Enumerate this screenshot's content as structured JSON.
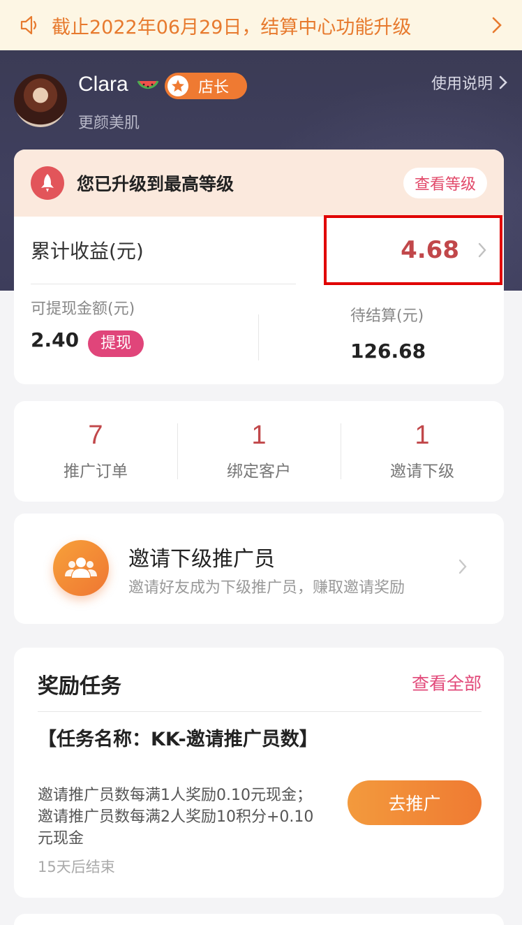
{
  "notice": {
    "text": "截止2022年06月29日，结算中心功能升级"
  },
  "profile": {
    "name": "Clara",
    "role_badge": "店长",
    "subtitle": "更颜美肌",
    "help_link": "使用说明"
  },
  "level": {
    "message": "您已升级到最高等级",
    "button": "查看等级"
  },
  "earnings": {
    "total_label": "累计收益(元)",
    "total_value": "4.68",
    "withdrawable_label": "可提现金额(元)",
    "withdrawable_value": "2.40",
    "withdraw_button": "提现",
    "pending_label": "待结算(元)",
    "pending_value": "126.68"
  },
  "stats": [
    {
      "value": "7",
      "label": "推广订单"
    },
    {
      "value": "1",
      "label": "绑定客户"
    },
    {
      "value": "1",
      "label": "邀请下级"
    }
  ],
  "invite": {
    "title": "邀请下级推广员",
    "subtitle": "邀请好友成为下级推广员，赚取邀请奖励"
  },
  "tasks": {
    "header": "奖励任务",
    "view_all": "查看全部",
    "item": {
      "name": "【任务名称：KK-邀请推广员数】",
      "description": "邀请推广员数每满1人奖励0.10元现金；邀请推广员数每满2人奖励10积分+0.10元现金",
      "ends": "15天后结束",
      "button": "去推广"
    }
  },
  "colors": {
    "accent_orange": "#ef7a32",
    "accent_pink": "#e0457a",
    "value_red": "#c1474a",
    "header_dark": "#3d3d5b"
  }
}
